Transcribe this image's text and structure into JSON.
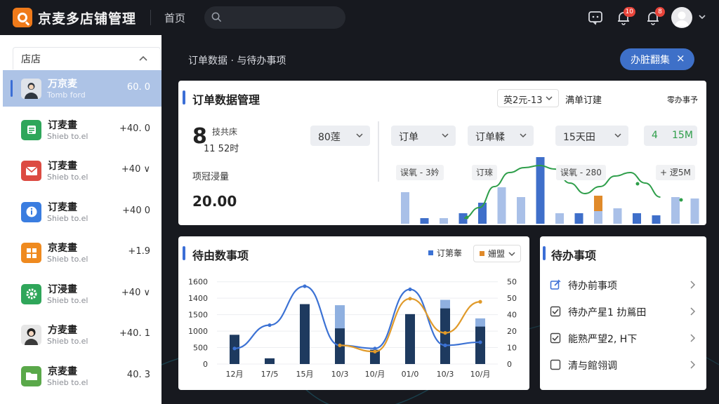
{
  "app": {
    "title": "京麦多店铺管理",
    "home_label": "首页",
    "search_placeholder": "",
    "notification_badge": "10",
    "message_badge": "8"
  },
  "sidebar": {
    "header": "店店",
    "items": [
      {
        "name": "万京麦",
        "sub": "Tomb ford",
        "value": "60. 0",
        "icon": "avatar-man-icon",
        "color": "#2f3640"
      },
      {
        "name": "订麦畫",
        "sub": "Shieb to.el",
        "value": "+40. 0",
        "icon": "list-icon",
        "color": "#2fa65a"
      },
      {
        "name": "订麦畫",
        "sub": "Shieb to.el",
        "value": "+40 ∨",
        "icon": "mail-icon",
        "color": "#dc4b42"
      },
      {
        "name": "订麦畫",
        "sub": "Shieb to.el",
        "value": "+40 0",
        "icon": "info-icon",
        "color": "#3a7de0"
      },
      {
        "name": "京麦畫",
        "sub": "Shieb to.el",
        "value": "+1.9",
        "icon": "grid-icon",
        "color": "#ef8a1f"
      },
      {
        "name": "订浸畫",
        "sub": "Shieb to.el",
        "value": "+40 ∨",
        "icon": "gear-icon",
        "color": "#2fa65a"
      },
      {
        "name": "方麦畫",
        "sub": "Shieb to.el",
        "value": "+40. 1",
        "icon": "avatar-woman-icon",
        "color": "#3a3a3a"
      },
      {
        "name": "京麦畫",
        "sub": "Shieb to.el",
        "value": "40. 3",
        "icon": "folder-icon",
        "color": "#5aa84a"
      }
    ]
  },
  "subheader": {
    "breadcrumb": "订单数据 · 与待办事项",
    "action_label": "办脏翻集",
    "action_close": "×"
  },
  "order_card": {
    "title": "订单数据管理",
    "date_select": "英2元-13",
    "full_orders": "满单订建",
    "todo_link": "零办事予",
    "big_number": "8",
    "big_label_1": "技共床",
    "big_label_2": "11 52时",
    "filter_1": "80莲",
    "metric_label": "项冠浸量",
    "metric_value": "20.00",
    "filter_orders": "订单",
    "filter_order_type": "订单輮",
    "filter_days": "15天田",
    "green_num": "4",
    "green_value": "15M",
    "chip_1": "误氧 - 3妗",
    "chip_2": "订琜",
    "chip_3": "误氧 - 280",
    "chip_4": "+ 逻5M"
  },
  "pending_card": {
    "title": "待由数事项",
    "legend_orders": "订第睾",
    "legend_select": "姗盟"
  },
  "todo_card": {
    "title": "待办事项",
    "items": [
      {
        "label": "待办前事项",
        "icon": "edit-icon"
      },
      {
        "label": "待办产星1 扐鶑田",
        "icon": "checkbox-checked-icon"
      },
      {
        "label": "能熟严望2, H下",
        "icon": "checkbox-checked-icon"
      },
      {
        "label": "清与館翎调",
        "icon": "checkbox-empty-icon"
      }
    ]
  },
  "colors": {
    "accent": "#3b6ed6",
    "bar_light": "#a9c0e8",
    "bar_dark": "#3f6fca",
    "bar_navy": "#1e3a5f",
    "bar_orange": "#e08a2a",
    "line_green": "#2e9e4a",
    "line_blue": "#3c72d4",
    "line_orange": "#e09a2a"
  },
  "chart_data": [
    {
      "type": "bar",
      "title": "",
      "note": "mini bar chart with overlaid green line in order card",
      "values": [
        45,
        8,
        8,
        15,
        30,
        52,
        38,
        95,
        15,
        15,
        18,
        22,
        15,
        12,
        38,
        36
      ],
      "highlight": [
        null,
        null,
        null,
        null,
        null,
        null,
        null,
        null,
        null,
        null,
        12,
        null,
        null,
        null,
        null,
        null
      ],
      "line": [
        10,
        25,
        55,
        75,
        82,
        85,
        80,
        60,
        45,
        55,
        70,
        75,
        60,
        40
      ]
    },
    {
      "type": "bar",
      "title": "",
      "categories": [
        "12月",
        "17/5",
        "15月",
        "10/3",
        "10/月",
        "01/0",
        "10/3",
        "10/月"
      ],
      "ylim_left": [
        0,
        1600
      ],
      "ylim_right": [
        0,
        50
      ],
      "yticks_left": [
        "0",
        "500",
        "1000",
        "1500",
        "1400",
        "1600"
      ],
      "yticks_right": [
        "0",
        "10",
        "20",
        "40",
        "50",
        "50"
      ],
      "series": [
        {
          "name": "",
          "values": [
            820,
            160,
            1680,
            1000,
            400,
            1400,
            1560,
            1050
          ]
        },
        {
          "name": "",
          "values": [
            0,
            0,
            0,
            1650,
            300,
            1230,
            1800,
            1280
          ]
        }
      ],
      "lines": [
        {
          "name": "",
          "values": [
            10,
            25,
            50,
            12,
            10,
            48,
            12,
            14
          ]
        },
        {
          "name": "",
          "values": [
            null,
            null,
            null,
            12,
            8,
            42,
            20,
            40
          ]
        }
      ]
    }
  ]
}
